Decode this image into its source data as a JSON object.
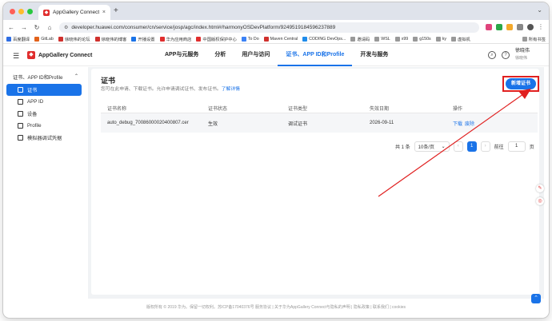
{
  "browser": {
    "tab_title": "AppGallery Connect",
    "tab_close": "×",
    "new_tab": "+",
    "url": "developer.huawei.com/consumer/cn/service/josp/agc/index.html#/harmonyOSDevPlatform/9249519184596237889",
    "bookmarks": [
      "百度翻译",
      "GitLab",
      "徐晓伟的论坛",
      "徐晓伟的博客",
      "开播设置",
      "华为应用商店",
      "中国版权保护中心",
      "To Do",
      "Maven Central",
      "CODING DevOps...",
      "邀请码",
      "WSL",
      "x99",
      "g150s",
      "ky",
      "虚拟机"
    ],
    "bookmarks_right": "所有书签",
    "colors": {
      "lights": [
        "#ff5f57",
        "#febc2e",
        "#28c840"
      ]
    }
  },
  "app": {
    "brand": "AppGallery Connect",
    "nav": [
      "APP与元服务",
      "分析",
      "用户与访问",
      "证书、APP ID和Profile",
      "开发与服务"
    ],
    "active_nav_index": 3,
    "user_name": "徐晓伟",
    "user_sub": "徐晓伟"
  },
  "sidebar": {
    "group": "证书、APP ID和Profile",
    "items": [
      "证书",
      "APP ID",
      "设备",
      "Profile",
      "模拟器调试凭据"
    ],
    "active_index": 0
  },
  "page": {
    "title": "证书",
    "desc": "您可在此申请、下载证书。允许申请调试证书、发布证书。",
    "desc_link": "了解详情",
    "new_button": "新增证书"
  },
  "table": {
    "headers": [
      "证书名称",
      "证书状态",
      "证书类型",
      "失效日期",
      "操作"
    ],
    "rows": [
      {
        "name": "auto_debug_70086000020400807.cer",
        "status": "生效",
        "type": "调试证书",
        "expiry": "2026-09-11",
        "actions": [
          "下载",
          "废除"
        ]
      }
    ]
  },
  "pager": {
    "total": "共 1 条",
    "page_size": "10条/页",
    "current": "1",
    "goto_label": "前往",
    "goto_value": "1",
    "page_suffix": "页"
  },
  "footer": "版权所有 © 2019 华为。保留一切权利。苏ICP备17040376号    服务协议 | 关于华为AppGallery Connect与隐私的声明 | 隐私政策 | 联系我们 | cookies",
  "accent": "#1a73e8",
  "annotation_color": "#e02020"
}
